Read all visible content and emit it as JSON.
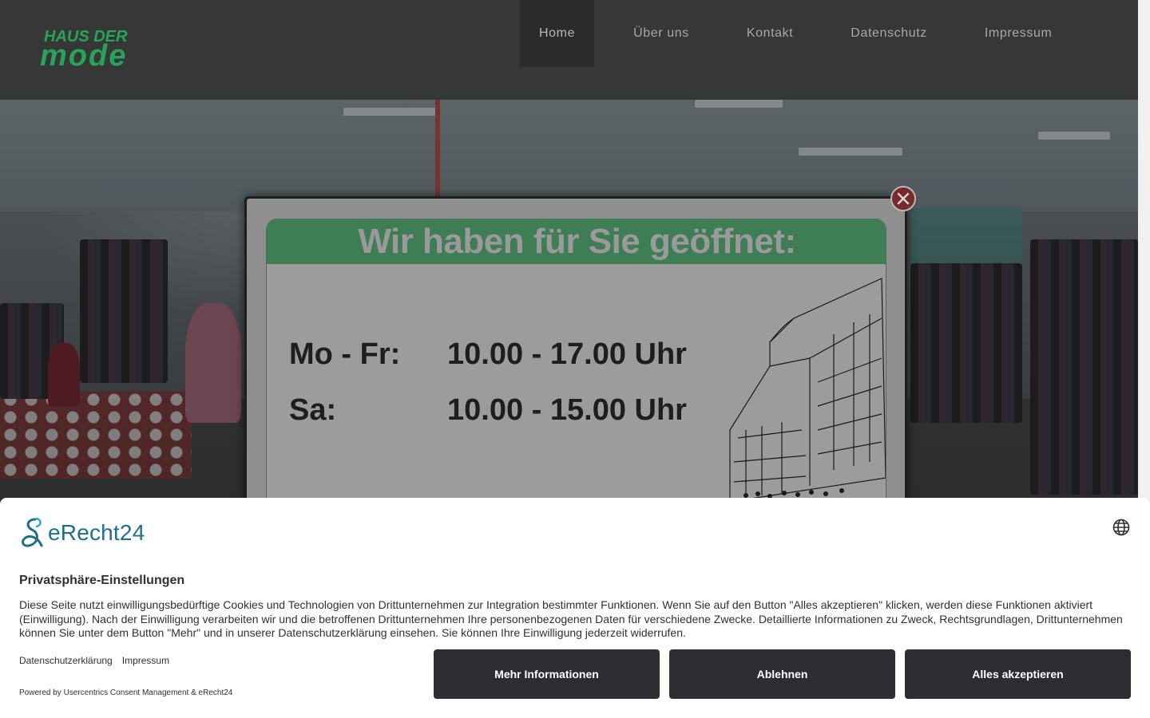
{
  "header": {
    "logo_top": "HAUS DER",
    "logo_bottom": "mode",
    "nav": [
      {
        "label": "Home",
        "active": true
      },
      {
        "label": "Über uns",
        "active": false
      },
      {
        "label": "Kontakt",
        "active": false
      },
      {
        "label": "Datenschutz",
        "active": false
      },
      {
        "label": "Impressum",
        "active": false
      }
    ]
  },
  "popup": {
    "title": "Wir haben für Sie geöffnet:",
    "hours": [
      {
        "day": "Mo - Fr:",
        "time": "10.00 - 17.00 Uhr"
      },
      {
        "day": "Sa:",
        "time": "10.00 - 15.00 Uhr"
      }
    ]
  },
  "consent": {
    "brand": "eRecht24",
    "title": "Privatsphäre-Einstellungen",
    "text": "Diese Seite nutzt einwilligungsbedürftige Cookies und Technologien von Drittunternehmen zur Integration bestimmter Funktionen. Wenn Sie auf den Button \"Alles akzeptieren\" klicken, werden diese Funktionen aktiviert (Einwilligung). Nach der Einwilligung verarbeiten wir und die betroffenen Drittunternehmen Ihre personenbezogenen Daten für verschiedene Zwecke. Detaillierte Informationen zu Zweck, Rechtsgrundlagen, Drittunternehmen können Sie unter dem Button \"Mehr\" und in unserer Datenschutzerklärung einsehen. Sie können Ihre Einwilligung jederzeit widerrufen.",
    "link_privacy": "Datenschutzerklärung",
    "link_imprint": "Impressum",
    "powered": "Powered by Usercentrics Consent Management & eRecht24",
    "buttons": {
      "more": "Mehr Informationen",
      "deny": "Ablehnen",
      "accept": "Alles akzeptieren"
    }
  },
  "colors": {
    "brand_green": "#3f7d55",
    "button_dark": "#2b2d30",
    "erecht_blue": "#1f6f8b"
  }
}
